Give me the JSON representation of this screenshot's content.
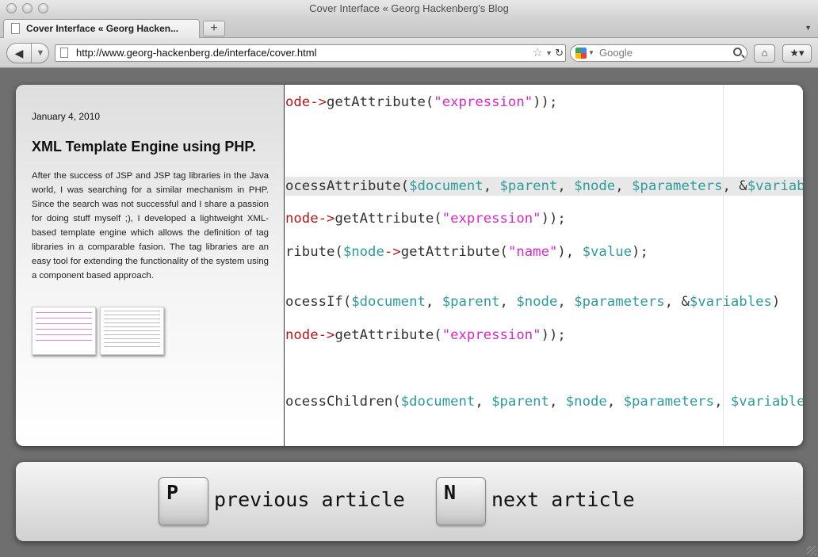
{
  "window": {
    "title": "Cover Interface « Georg Hackenberg's Blog"
  },
  "tabs": [
    {
      "label": "Cover Interface « Georg Hacken...",
      "active": true
    }
  ],
  "toolbar": {
    "new_tab_label": "+",
    "url": "http://www.georg-hackenberg.de/interface/cover.html",
    "search_placeholder": "Google",
    "icons": [
      "back-icon",
      "forward-icon",
      "page-icon",
      "star-icon",
      "reload-icon",
      "google-icon",
      "search-icon",
      "home-icon",
      "bookmarks-icon"
    ]
  },
  "post": {
    "date": "January 4, 2010",
    "title": "XML Template Engine using PHP.",
    "body": "After the success of JSP and JSP tag libraries in the Java world, I was searching for a similar mechanism in PHP. Since the search was not successful and I share a passion for doing stuff myself ;), I developed a lightweight XML-based template engine which allows the definition of tag libraries in a comparable fasion. The tag libraries are an easy tool for extending the functionality of the system using a component based approach."
  },
  "code_lines": [
    [
      [
        "k",
        "ode->"
      ],
      [
        "p",
        "getAttribute("
      ],
      [
        "s",
        "\"expression\""
      ],
      [
        "p",
        "));"
      ]
    ],
    [
      [
        "p",
        "ocessAttribute("
      ],
      [
        "v",
        "$document"
      ],
      [
        "p",
        ", "
      ],
      [
        "v",
        "$parent"
      ],
      [
        "p",
        ", "
      ],
      [
        "v",
        "$node"
      ],
      [
        "p",
        ", "
      ],
      [
        "v",
        "$parameters"
      ],
      [
        "p",
        ", &"
      ],
      [
        "v",
        "$variables"
      ]
    ],
    [
      [
        "k",
        "node->"
      ],
      [
        "p",
        "getAttribute("
      ],
      [
        "s",
        "\"expression\""
      ],
      [
        "p",
        "));"
      ]
    ],
    [
      [
        "p",
        "ribute("
      ],
      [
        "v",
        "$node"
      ],
      [
        "k",
        "->"
      ],
      [
        "p",
        "getAttribute("
      ],
      [
        "s",
        "\"name\""
      ],
      [
        "p",
        "), "
      ],
      [
        "v",
        "$value"
      ],
      [
        "p",
        ");"
      ]
    ],
    [
      [
        "p",
        "ocessIf("
      ],
      [
        "v",
        "$document"
      ],
      [
        "p",
        ", "
      ],
      [
        "v",
        "$parent"
      ],
      [
        "p",
        ", "
      ],
      [
        "v",
        "$node"
      ],
      [
        "p",
        ", "
      ],
      [
        "v",
        "$parameters"
      ],
      [
        "p",
        ", &"
      ],
      [
        "v",
        "$variables"
      ],
      [
        "p",
        ")"
      ]
    ],
    [
      [
        "k",
        "node->"
      ],
      [
        "p",
        "getAttribute("
      ],
      [
        "s",
        "\"expression\""
      ],
      [
        "p",
        "));"
      ]
    ],
    [
      [
        "p",
        "ocessChildren("
      ],
      [
        "v",
        "$document"
      ],
      [
        "p",
        ", "
      ],
      [
        "v",
        "$parent"
      ],
      [
        "p",
        ", "
      ],
      [
        "v",
        "$node"
      ],
      [
        "p",
        ", "
      ],
      [
        "v",
        "$parameters"
      ],
      [
        "p",
        ", "
      ],
      [
        "v",
        "$variables"
      ],
      [
        "p",
        ");"
      ]
    ]
  ],
  "navigation": {
    "prev_key": "P",
    "prev_label": "previous article",
    "next_key": "N",
    "next_label": "next article"
  },
  "colors": {
    "keyword": "#b21818",
    "string": "#d52ac9",
    "variable": "#2e9b9b",
    "background": "#6f6f6f"
  }
}
